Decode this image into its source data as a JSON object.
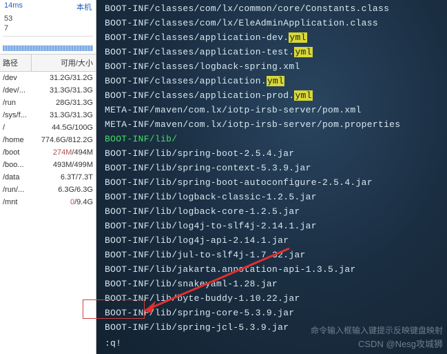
{
  "stats": {
    "time": "14ms",
    "host": "本机",
    "n1": "53",
    "n2": "7"
  },
  "table": {
    "col_path": "路径",
    "col_size": "可用/大小"
  },
  "disks": [
    {
      "path": "/dev",
      "size": "31.2G/31.2G",
      "low": false
    },
    {
      "path": "/dev/...",
      "size": "31.3G/31.3G",
      "low": false
    },
    {
      "path": "/run",
      "size": "28G/31.3G",
      "low": false
    },
    {
      "path": "/sys/f...",
      "size": "31.3G/31.3G",
      "low": false
    },
    {
      "path": "/",
      "size": "44.5G/100G",
      "low": false
    },
    {
      "path": "/home",
      "size": "774.6G/812.2G",
      "low": false
    },
    {
      "path": "/boot",
      "size": "274M/494M",
      "low": true
    },
    {
      "path": "/boo...",
      "size": "493M/499M",
      "low": false
    },
    {
      "path": "/data",
      "size": "6.3T/7.3T",
      "low": false
    },
    {
      "path": "/run/...",
      "size": "6.3G/6.3G",
      "low": false
    },
    {
      "path": "/mnt",
      "size": "0/9.4G",
      "low": true
    }
  ],
  "listing": [
    {
      "pre": "BOOT-INF/classes/com/lx/common/core/Constants.class",
      "hl": "",
      "post": ""
    },
    {
      "pre": "BOOT-INF/classes/com/lx/EleAdminApplication.class",
      "hl": "",
      "post": ""
    },
    {
      "pre": "BOOT-INF/classes/application-dev.",
      "hl": "yml",
      "post": ""
    },
    {
      "pre": "BOOT-INF/classes/application-test.",
      "hl": "yml",
      "post": ""
    },
    {
      "pre": "BOOT-INF/classes/logback-spring.xml",
      "hl": "",
      "post": ""
    },
    {
      "pre": "BOOT-INF/classes/application.",
      "hl": "yml",
      "post": ""
    },
    {
      "pre": "BOOT-INF/classes/application-prod.",
      "hl": "yml",
      "post": ""
    },
    {
      "pre": "META-INF/maven/com.lx/iotp-irsb-server/pom.xml",
      "hl": "",
      "post": ""
    },
    {
      "pre": "META-INF/maven/com.lx/iotp-irsb-server/pom.properties",
      "hl": "",
      "post": ""
    },
    {
      "pre": "",
      "hl": "",
      "post": "",
      "green": "BOOT-INF/lib/"
    },
    {
      "pre": "BOOT-INF/lib/spring-boot-2.5.4.jar",
      "hl": "",
      "post": ""
    },
    {
      "pre": "BOOT-INF/lib/spring-context-5.3.9.jar",
      "hl": "",
      "post": ""
    },
    {
      "pre": "BOOT-INF/lib/spring-boot-autoconfigure-2.5.4.jar",
      "hl": "",
      "post": ""
    },
    {
      "pre": "BOOT-INF/lib/logback-classic-1.2.5.jar",
      "hl": "",
      "post": ""
    },
    {
      "pre": "BOOT-INF/lib/logback-core-1.2.5.jar",
      "hl": "",
      "post": ""
    },
    {
      "pre": "BOOT-INF/lib/log4j-to-slf4j-2.14.1.jar",
      "hl": "",
      "post": ""
    },
    {
      "pre": "BOOT-INF/lib/log4j-api-2.14.1.jar",
      "hl": "",
      "post": ""
    },
    {
      "pre": "BOOT-INF/lib/jul-to-slf4j-1.7.32.jar",
      "hl": "",
      "post": ""
    },
    {
      "pre": "BOOT-INF/lib/jakarta.annotation-api-1.3.5.jar",
      "hl": "",
      "post": ""
    },
    {
      "pre": "BOOT-INF/lib/snakeyaml-1.28.jar",
      "hl": "",
      "post": ""
    },
    {
      "pre": "BOOT-INF/lib/byte-buddy-1.10.22.jar",
      "hl": "",
      "post": ""
    },
    {
      "pre": "BOOT-INF/lib/spring-core-5.3.9.jar",
      "hl": "",
      "post": ""
    },
    {
      "pre": "BOOT-INF/lib/spring-jcl-5.3.9.jar",
      "hl": "",
      "post": ""
    }
  ],
  "cmd": ":q!",
  "hint": "命令输入框输入键提示反映键盘映射",
  "watermark": "CSDN @Nesg攻城狮"
}
